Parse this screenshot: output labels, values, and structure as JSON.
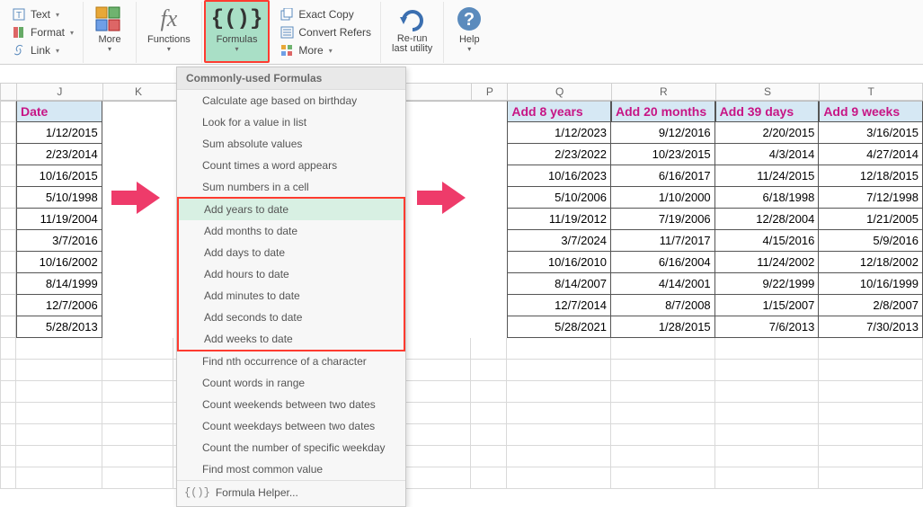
{
  "ribbon": {
    "text_btn": "Text",
    "format_btn": "Format",
    "link_btn": "Link",
    "more1": "More",
    "functions": "Functions",
    "formulas": "Formulas",
    "exact_copy": "Exact Copy",
    "convert_refers": "Convert Refers",
    "more2": "More",
    "rerun": "Re-run\nlast utility",
    "help": "Help"
  },
  "menu": {
    "header": "Commonly-used Formulas",
    "items_top": [
      "Calculate age based on birthday",
      "Look for a value in list",
      "Sum absolute values",
      "Count times a word appears",
      "Sum numbers in a cell"
    ],
    "items_highlight": [
      "Add years to date",
      "Add months to date",
      "Add days to date",
      "Add hours to date",
      "Add minutes to date",
      "Add seconds to date",
      "Add weeks to date"
    ],
    "items_bottom": [
      "Find nth occurrence of a character",
      "Count words in range",
      "Count weekends between two dates",
      "Count weekdays between two dates",
      "Count the number of specific weekday",
      "Find most common value"
    ],
    "footer": "Formula Helper...",
    "footer_icon": "{()}"
  },
  "columns": {
    "J": "J",
    "K": "K",
    "P": "P",
    "Q": "Q",
    "R": "R",
    "S": "S",
    "T": "T"
  },
  "table1": {
    "header": "Date",
    "rows": [
      "1/12/2015",
      "2/23/2014",
      "10/16/2015",
      "5/10/1998",
      "11/19/2004",
      "3/7/2016",
      "10/16/2002",
      "8/14/1999",
      "12/7/2006",
      "5/28/2013"
    ]
  },
  "table2": {
    "headers": [
      "Add 8 years",
      "Add 20 months",
      "Add 39 days",
      "Add 9 weeks"
    ],
    "rows": [
      [
        "1/12/2023",
        "9/12/2016",
        "2/20/2015",
        "3/16/2015"
      ],
      [
        "2/23/2022",
        "10/23/2015",
        "4/3/2014",
        "4/27/2014"
      ],
      [
        "10/16/2023",
        "6/16/2017",
        "11/24/2015",
        "12/18/2015"
      ],
      [
        "5/10/2006",
        "1/10/2000",
        "6/18/1998",
        "7/12/1998"
      ],
      [
        "11/19/2012",
        "7/19/2006",
        "12/28/2004",
        "1/21/2005"
      ],
      [
        "3/7/2024",
        "11/7/2017",
        "4/15/2016",
        "5/9/2016"
      ],
      [
        "10/16/2010",
        "6/16/2004",
        "11/24/2002",
        "12/18/2002"
      ],
      [
        "8/14/2007",
        "4/14/2001",
        "9/22/1999",
        "10/16/1999"
      ],
      [
        "12/7/2014",
        "8/7/2008",
        "1/15/2007",
        "2/8/2007"
      ],
      [
        "5/28/2021",
        "1/28/2015",
        "7/6/2013",
        "7/30/2013"
      ]
    ]
  }
}
